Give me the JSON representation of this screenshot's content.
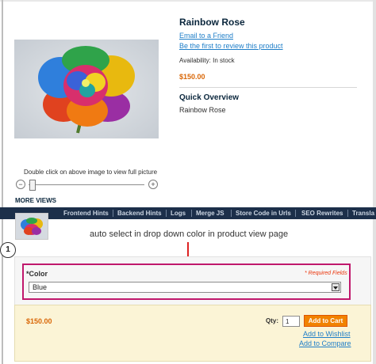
{
  "product": {
    "name": "Rainbow Rose",
    "email_friend": "Email to a Friend",
    "review_link": "Be the first to review this product",
    "availability": "Availability: In stock",
    "price": "$150.00",
    "overview_heading": "Quick Overview",
    "overview_text": "Rainbow Rose"
  },
  "image_zoom": {
    "hint": "Double click on above image to view full picture",
    "minus": "−",
    "plus": "+",
    "level": 0.0
  },
  "more_views": "MORE VIEWS",
  "nav": {
    "items": [
      "Frontend Hints",
      "Backend Hints",
      "Logs",
      "Merge JS",
      "Store Code in Urls",
      "SEO Rewrites",
      "Transla"
    ]
  },
  "annotation": {
    "text": "auto select in drop down color in product view page",
    "step_number": "1"
  },
  "options": {
    "color_label": "*Color",
    "required_note": "* Required Fields",
    "selected_value": "Blue"
  },
  "buy": {
    "price": "$150.00",
    "qty_label": "Qty:",
    "qty_value": "1",
    "add_to_cart": "Add to Cart",
    "add_to_wishlist": "Add to Wishlist",
    "add_to_compare": "Add to Compare"
  },
  "colors": {
    "price": "#d96708",
    "link": "#1e7ec8",
    "button": "#f18200",
    "highlight": "#c0186c",
    "nav_bg": "#1c2f4a"
  }
}
